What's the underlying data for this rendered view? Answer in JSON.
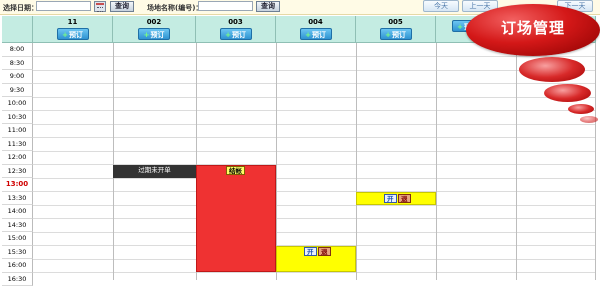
{
  "toolbar": {
    "date_label": "选择日期：",
    "date_value": "",
    "query_label": "查询",
    "venue_label": "场地名称(编号)：",
    "venue_value": "",
    "query2_label": "查询",
    "today_label": "今天",
    "prev_label": "上一天",
    "next_label": "下一天"
  },
  "logo": {
    "text": "订场管理"
  },
  "book_label": "预订",
  "courts": [
    {
      "name": "11"
    },
    {
      "name": "002"
    },
    {
      "name": "003"
    },
    {
      "name": "004"
    },
    {
      "name": "005"
    },
    {
      "name": ""
    },
    {
      "name": ""
    }
  ],
  "times": [
    "8:00",
    "8:30",
    "9:00",
    "9:30",
    "10:00",
    "10:30",
    "11:00",
    "11:30",
    "12:00",
    "12:30",
    "13:00",
    "13:30",
    "14:00",
    "14:30",
    "15:00",
    "15:30",
    "16:00",
    "16:30"
  ],
  "current_time": "13:00",
  "bookings": {
    "expired": {
      "label": "过期未开单"
    },
    "settle": {
      "label": "结帐"
    },
    "open1": {
      "open_label": "开",
      "refund_label": "退"
    },
    "open2": {
      "open_label": "开",
      "refund_label": "退"
    }
  },
  "colors": {
    "header_bg": "#c4ece2",
    "booked_red": "#ef3232",
    "pending_yellow": "#ffff00",
    "expired_dark": "#333333",
    "logo_red": "#d41818"
  }
}
